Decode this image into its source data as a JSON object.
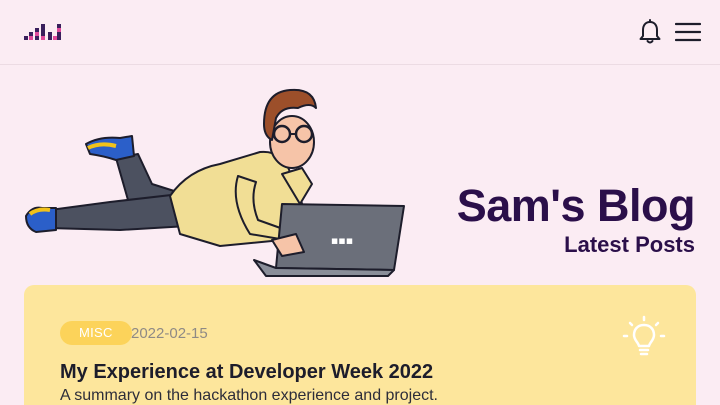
{
  "header": {
    "logo_icon": "sld-logo-icon",
    "notifications_icon": "bell-icon",
    "menu_icon": "hamburger-menu-icon"
  },
  "hero": {
    "title": "Sam's Blog",
    "subtitle": "Latest Posts",
    "illustration_icon": "person-lying-with-laptop-illustration"
  },
  "posts": [
    {
      "tag": "MISC",
      "date": "2022-02-15",
      "title": "My Experience at Developer Week 2022",
      "summary": "A summary on the hackathon experience and project.",
      "icon": "lightbulb-icon"
    }
  ],
  "colors": {
    "background": "#fbecf3",
    "heading": "#2b0f4a",
    "card": "#fde69c",
    "tag": "#fcd35a"
  }
}
